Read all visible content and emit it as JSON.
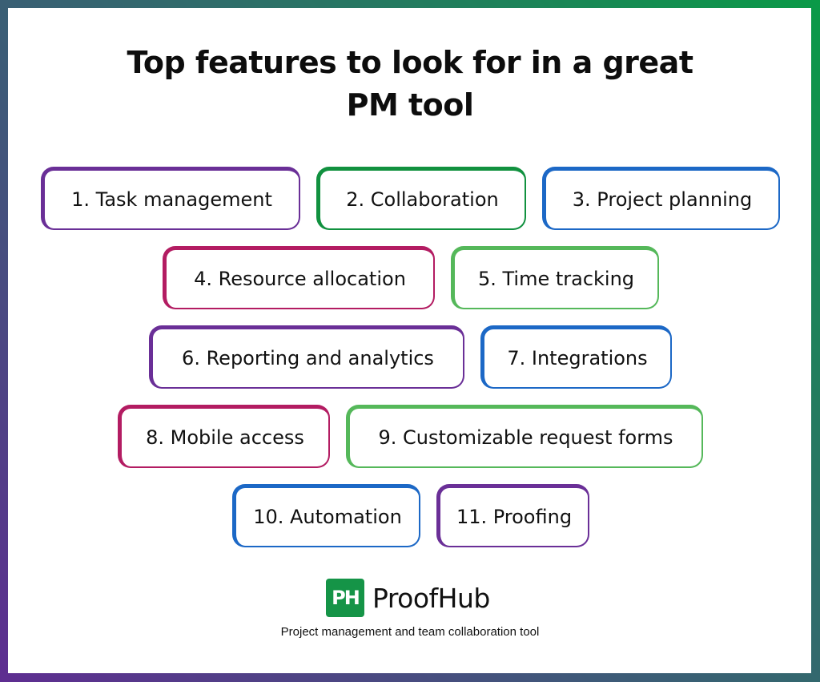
{
  "title": {
    "line1": "Top features to look for in a great",
    "line2": "PM tool"
  },
  "features": [
    {
      "label": "1. Task management",
      "color": "#6a2f97"
    },
    {
      "label": "2. Collaboration",
      "color": "#11913f"
    },
    {
      "label": "3. Project planning",
      "color": "#1c68c6"
    },
    {
      "label": "4. Resource allocation",
      "color": "#b31c62"
    },
    {
      "label": "5. Time tracking",
      "color": "#55b85a"
    },
    {
      "label": "6. Reporting and analytics",
      "color": "#6a2f97"
    },
    {
      "label": "7. Integrations",
      "color": "#1c68c6"
    },
    {
      "label": "8. Mobile access",
      "color": "#b31c62"
    },
    {
      "label": "9. Customizable request forms",
      "color": "#55b85a"
    },
    {
      "label": "10. Automation",
      "color": "#1c68c6"
    },
    {
      "label": "11. Proofing",
      "color": "#6a2f97"
    }
  ],
  "brand": {
    "logo_text": "PH",
    "name": "ProofHub",
    "logo_color": "#159447",
    "tagline": "Project management and team collaboration tool"
  },
  "frame_colors": {
    "top_left": "#2f6d6a",
    "top_right": "#0a9a47",
    "bottom_left": "#5e2d91",
    "bottom_right": "#336b70"
  }
}
